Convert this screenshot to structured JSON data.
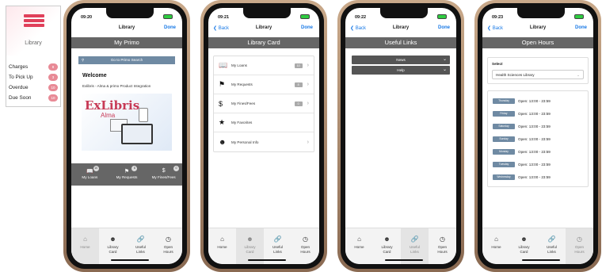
{
  "widget": {
    "title": "Library",
    "rows": [
      {
        "label": "Charges",
        "count": "8"
      },
      {
        "label": "To Pick Up",
        "count": "3"
      },
      {
        "label": "Overdue",
        "count": "10"
      },
      {
        "label": "Due Soon",
        "count": "10"
      }
    ]
  },
  "common": {
    "nav_title": "Library",
    "done": "Done",
    "back": "Back",
    "tabs": {
      "home": "Home",
      "library_card_1": "Library",
      "library_card_2": "Card",
      "useful_links_1": "Useful",
      "useful_links_2": "Links",
      "open_hours_1": "Open",
      "open_hours_2": "Hours"
    }
  },
  "phone1": {
    "time": "09:20",
    "header": "My Primo",
    "search_label": "Go to Primo Search",
    "welcome": "Welcome",
    "integration": "Exlibris - Alma & primo Product Integration",
    "brand": "ExLibris",
    "brand_sub": "Alma",
    "quick": [
      {
        "label": "My Loans",
        "count": "10"
      },
      {
        "label": "My Requests",
        "count": "8"
      },
      {
        "label": "My Fines/Fees",
        "count": "0"
      }
    ]
  },
  "phone2": {
    "time": "09:21",
    "header": "Library Card",
    "items": [
      {
        "label": "My Loans",
        "count": "10"
      },
      {
        "label": "My Requests",
        "count": "8"
      },
      {
        "label": "My Fines/Fees",
        "count": "0"
      },
      {
        "label": "My Favorites",
        "count": ""
      },
      {
        "label": "My Personal Info",
        "count": ""
      }
    ]
  },
  "phone3": {
    "time": "09:22",
    "header": "Useful Links",
    "sections": [
      "News",
      "Help"
    ]
  },
  "phone4": {
    "time": "09:23",
    "header": "Open Hours",
    "select_label": "Select",
    "select_value": "Health Sciences Library",
    "hours": [
      {
        "day": "Thursday",
        "time": "Open: 13:00 - 23:59"
      },
      {
        "day": "Friday",
        "time": "Open: 13:00 - 23:59"
      },
      {
        "day": "Saturday",
        "time": "Open: 13:00 - 23:59"
      },
      {
        "day": "Sunday",
        "time": "Open: 13:00 - 23:59"
      },
      {
        "day": "Monday",
        "time": "Open: 13:00 - 23:59"
      },
      {
        "day": "Tuesday",
        "time": "Open: 13:00 - 23:59"
      },
      {
        "day": "Wednesday",
        "time": "Open: 13:00 - 23:59"
      }
    ]
  }
}
